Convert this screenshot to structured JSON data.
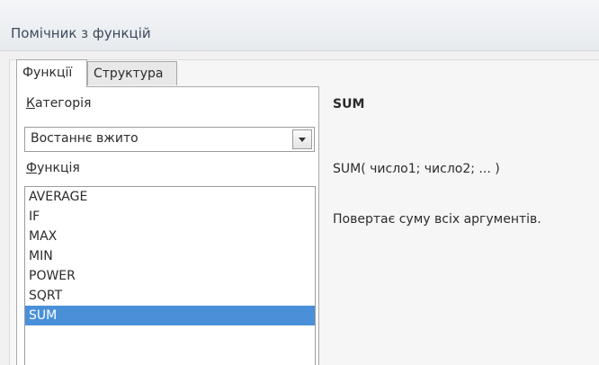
{
  "window": {
    "title": "Помічник з функцій"
  },
  "tabs": [
    {
      "label": "Функції",
      "active": true
    },
    {
      "label": "Структура",
      "active": false
    }
  ],
  "category": {
    "label_mnemonic": "К",
    "label_rest": "атегорія",
    "selected": "Востаннє вжито"
  },
  "function_list": {
    "label_mnemonic": "Ф",
    "label_rest": "ункція",
    "items": [
      "AVERAGE",
      "IF",
      "MAX",
      "MIN",
      "POWER",
      "SQRT",
      "SUM"
    ],
    "selected": "SUM"
  },
  "details": {
    "name": "SUM",
    "syntax": "SUM( число1; число2; ... )",
    "description": "Повертає суму всіх аргументів."
  },
  "colors": {
    "selection": "#4a90d9",
    "title_text": "#3b4a5c"
  }
}
